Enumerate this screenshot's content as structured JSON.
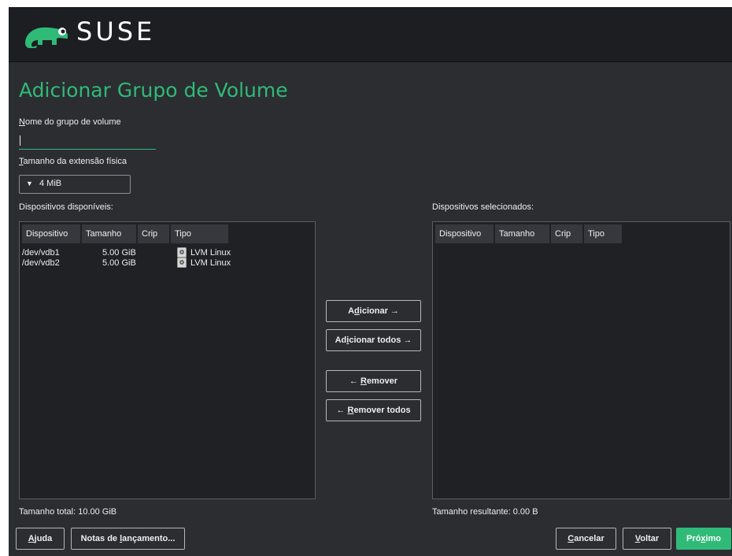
{
  "header": {
    "logo_text": "SUSE"
  },
  "title": "Adicionar Grupo de Volume",
  "vg_name": {
    "label_first": "N",
    "label_rest": "ome do grupo de volume",
    "value": ""
  },
  "extent": {
    "label_first": "T",
    "label_rest": "amanho da extensão física",
    "selected": "4 MiB"
  },
  "available": {
    "label": "Dispositivos disponíveis:",
    "columns": [
      "Dispositivo",
      "Tamanho",
      "Crip",
      "Tipo"
    ],
    "rows": [
      {
        "device": "/dev/vdb1",
        "size": "5.00 GiB",
        "crypt": "",
        "type": "LVM Linux"
      },
      {
        "device": "/dev/vdb2",
        "size": "5.00 GiB",
        "crypt": "",
        "type": "LVM Linux"
      }
    ],
    "total": "Tamanho total: 10.00 GiB"
  },
  "selected": {
    "label": "Dispositivos selecionados:",
    "columns": [
      "Dispositivo",
      "Tamanho",
      "Crip",
      "Tipo"
    ],
    "rows": [],
    "total": "Tamanho resultante: 0.00 B"
  },
  "transfer": {
    "add": {
      "pre": "A",
      "key": "d",
      "post": "icionar →"
    },
    "add_all": {
      "pre": "Ad",
      "key": "i",
      "post": "cionar todos →"
    },
    "remove": {
      "pre": "← ",
      "key": "R",
      "post": "emover"
    },
    "remove_all": {
      "pre": "← ",
      "key": "R",
      "post": "emover todos"
    }
  },
  "footer": {
    "help": {
      "key": "A",
      "post": "juda"
    },
    "release_notes": {
      "pre": "Notas de ",
      "key": "l",
      "post": "ançamento..."
    },
    "cancel": {
      "key": "C",
      "post": "ancelar"
    },
    "back": {
      "key": "V",
      "post": "oltar"
    },
    "next": {
      "pre": "Pró",
      "key": "x",
      "post": "imo"
    }
  },
  "colors": {
    "accent": "#30ba78",
    "background": "#2b2d31",
    "header": "#1c1e22",
    "table_bg": "#1f2124"
  }
}
